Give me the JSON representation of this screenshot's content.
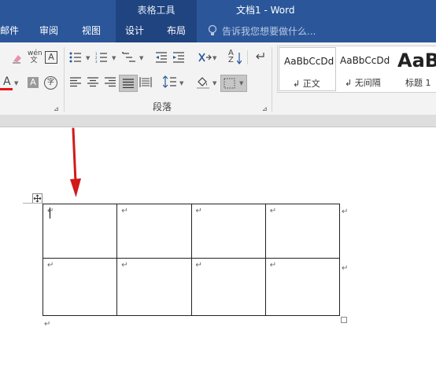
{
  "title_bar": {
    "context_tab_group": "表格工具",
    "document_title": "文档1 - Word"
  },
  "tabs": [
    {
      "label": "邮件"
    },
    {
      "label": "审阅"
    },
    {
      "label": "视图"
    },
    {
      "label": "设计"
    },
    {
      "label": "布局"
    }
  ],
  "tell_me": "告诉我您想要做什么...",
  "ribbon": {
    "paragraph_group_label": "段落",
    "phonetic_guide_top": "wén",
    "phonetic_guide_bottom": "文",
    "char_border_glyph": "A",
    "font_color_glyph": "A",
    "char_shading_glyph": "A",
    "enclose_char_glyph": "字",
    "sort_glyph_top": "A",
    "sort_glyph_bottom": "Z",
    "styles": [
      {
        "sample": "AaBbCcDd",
        "name": "↲ 正文"
      },
      {
        "sample": "AaBbCcDd",
        "name": "↲ 无间隔"
      },
      {
        "sample": "AaB",
        "name": "标题 1"
      }
    ]
  },
  "document": {
    "table": {
      "rows": [
        [
          "↵",
          "↵",
          "↵",
          "↵"
        ],
        [
          "↵",
          "↵",
          "↵",
          "↵"
        ]
      ],
      "end_of_row_marks": [
        "↵",
        "↵"
      ]
    },
    "paragraph_mark_after_table": "↵"
  },
  "colors": {
    "ribbon_blue": "#2b579a",
    "context_group": "#1f4480",
    "font_color_underline": "#e8141b",
    "annotation_arrow": "#d11a1a"
  }
}
